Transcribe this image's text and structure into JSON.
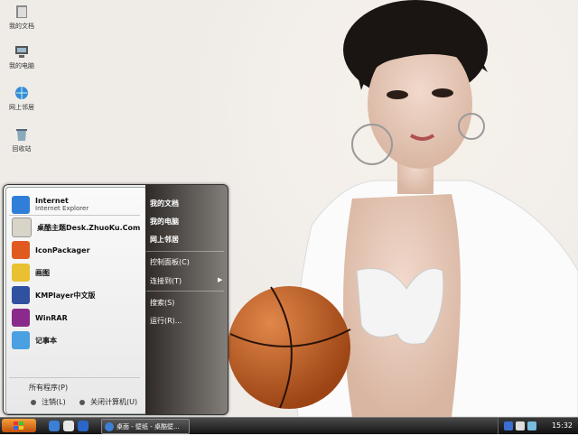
{
  "desktop_icons": [
    {
      "label": "我的文档",
      "icon": "folder-documents-icon"
    },
    {
      "label": "我的电脑",
      "icon": "computer-icon"
    },
    {
      "label": "网上邻居",
      "icon": "network-icon"
    },
    {
      "label": "回收站",
      "icon": "recycle-bin-icon"
    }
  ],
  "start_menu": {
    "programs": [
      {
        "label": "Internet",
        "sub": "Internet Explorer",
        "icon": "ie-icon",
        "color": "#2f7fd8"
      },
      {
        "label": "桌酷主题Desk.ZhuoKu.Com",
        "icon": "zhuoku-icon",
        "color": "#d8d4c8"
      },
      {
        "label": "IconPackager",
        "icon": "iconpackager-icon",
        "color": "#e05a20"
      },
      {
        "label": "画图",
        "icon": "paint-icon",
        "color": "#e8c030"
      },
      {
        "label": "KMPlayer中文版",
        "icon": "kmplayer-icon",
        "color": "#3050a0"
      },
      {
        "label": "WinRAR",
        "icon": "winrar-icon",
        "color": "#8a2a8a"
      },
      {
        "label": "记事本",
        "icon": "notepad-icon",
        "color": "#4aa0e0"
      }
    ],
    "all_programs": "所有程序(P)",
    "logoff": "注销(L)",
    "shutdown": "关闭计算机(U)",
    "right_items": [
      {
        "label": "我的文档",
        "bold": true
      },
      {
        "label": "我的电脑",
        "bold": true
      },
      {
        "label": "网上邻居",
        "bold": true
      },
      {
        "label": "控制面板(C)",
        "bold": false
      },
      {
        "label": "连接到(T)",
        "bold": false
      },
      {
        "label": "搜索(S)",
        "bold": false
      },
      {
        "label": "运行(R)...",
        "bold": false
      }
    ]
  },
  "taskbar": {
    "task_label": "桌面 - 壁纸 - 桌酷壁...",
    "clock": "15:32"
  },
  "colors": {
    "start_button": "#e07820",
    "taskbar": "#1e1e1e"
  }
}
